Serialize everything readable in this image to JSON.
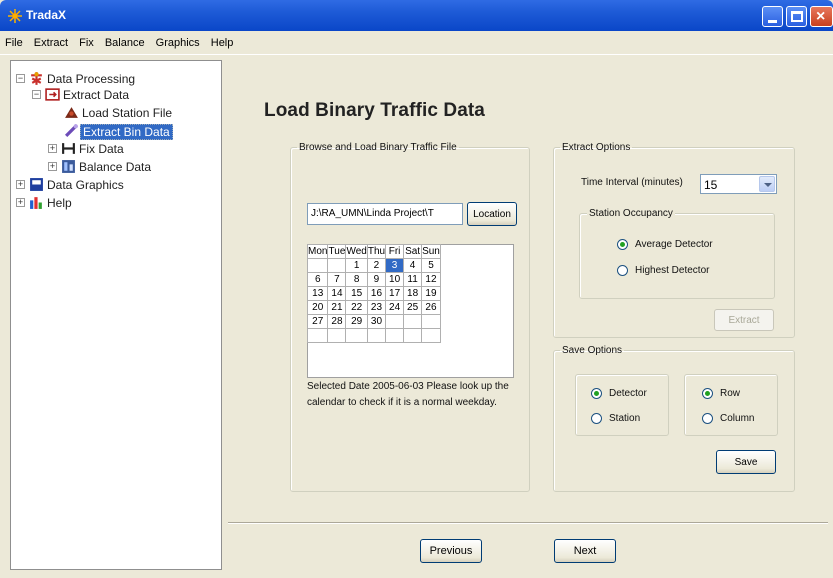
{
  "window": {
    "title": "TradaX"
  },
  "menu": [
    "File",
    "Extract",
    "Fix",
    "Balance",
    "Graphics",
    "Help"
  ],
  "tree": {
    "items": [
      {
        "label": "Data Processing",
        "expander": "−"
      },
      {
        "label": "Extract Data",
        "expander": "−"
      },
      {
        "label": "Load Station File"
      },
      {
        "label": "Extract Bin Data",
        "selected": true
      },
      {
        "label": "Fix Data",
        "expander": "+"
      },
      {
        "label": "Balance Data",
        "expander": "+"
      },
      {
        "label": "Data Graphics",
        "expander": "+"
      },
      {
        "label": "Help",
        "expander": "+"
      }
    ]
  },
  "main": {
    "title": "Load Binary Traffic Data",
    "browse": {
      "legend": "Browse and Load Binary Traffic File",
      "path": "J:\\RA_UMN\\Linda Project\\T",
      "location_label": "Location"
    },
    "calendar": {
      "headers": [
        "Mon",
        "Tue",
        "Wed",
        "Thu",
        "Fri",
        "Sat",
        "Sun"
      ],
      "rows": [
        [
          "",
          "",
          "1",
          "2",
          "3",
          "4",
          "5"
        ],
        [
          "6",
          "7",
          "8",
          "9",
          "10",
          "11",
          "12"
        ],
        [
          "13",
          "14",
          "15",
          "16",
          "17",
          "18",
          "19"
        ],
        [
          "20",
          "21",
          "22",
          "23",
          "24",
          "25",
          "26"
        ],
        [
          "27",
          "28",
          "29",
          "30",
          "",
          "",
          ""
        ],
        [
          "",
          "",
          "",
          "",
          "",
          "",
          ""
        ]
      ],
      "selected": "3"
    },
    "info": "Selected Date 2005-06-03  Please  look up the calendar to check if it is a  normal weekday.",
    "extract": {
      "legend": "Extract Options",
      "interval_label": "Time Interval (minutes)",
      "interval_value": "15",
      "occupancy_legend": "Station Occupancy",
      "average_label": "Average Detector",
      "highest_label": "Highest Detector",
      "extract_label": "Extract"
    },
    "save": {
      "legend": "Save Options",
      "detector_label": "Detector",
      "station_label": "Station",
      "row_label": "Row",
      "column_label": "Column",
      "save_label": "Save"
    },
    "nav": {
      "previous_label": "Previous",
      "next_label": "Next"
    }
  }
}
